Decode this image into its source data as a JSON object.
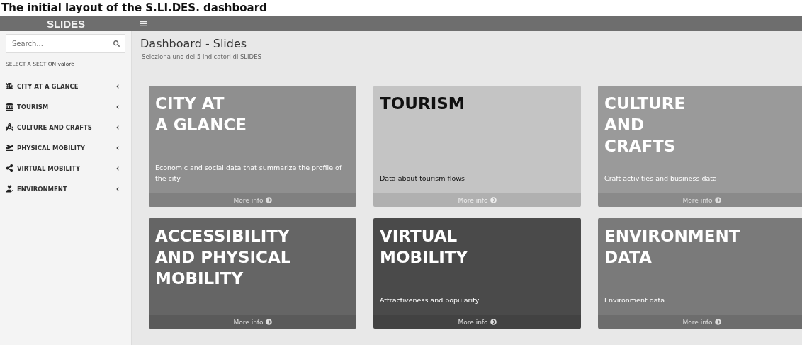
{
  "caption": "The initial layout of the S.LI.DES. dashboard",
  "header": {
    "logo": "SLIDES",
    "menu_glyph": "≡"
  },
  "sidebar": {
    "search": {
      "placeholder": "Search..."
    },
    "section_label": "SELECT A SECTION valore",
    "items": [
      {
        "label": "CITY AT A GLANCE",
        "expanded": false
      },
      {
        "label": "TOURISM",
        "expanded": false
      },
      {
        "label": "CULTURE AND CRAFTS",
        "expanded": false
      },
      {
        "label": "PHYSICAL MOBILITY",
        "expanded": false
      },
      {
        "label": "VIRTUAL MOBILITY",
        "expanded": false
      },
      {
        "label": "ENVIRONMENT",
        "expanded": false
      }
    ]
  },
  "main": {
    "title": "Dashboard - Slides",
    "subtitle": "Seleziona uno dei 5 indicatori di SLIDES",
    "cards": [
      {
        "title_lines": [
          "CITY AT",
          "A GLANCE"
        ],
        "description": "Economic and social data that summarize the profile of the city",
        "link": "More info",
        "color": "#8f8f8f"
      },
      {
        "title_lines": [
          "TOURISM"
        ],
        "description": "Data about tourism flows",
        "link": "More info",
        "color": "#c4c4c4"
      },
      {
        "title_lines": [
          "CULTURE",
          "AND",
          "CRAFTS"
        ],
        "description": "Craft activities and business data",
        "link": "More info",
        "color": "#9a9a9a"
      },
      {
        "title_lines": [
          "ACCESSIBILITY",
          "AND PHYSICAL",
          "MOBILITY"
        ],
        "link": "More info",
        "color": "#656565"
      },
      {
        "title_lines": [
          "VIRTUAL",
          "MOBILITY"
        ],
        "description": "Attractiveness and popularity",
        "link": "More info",
        "color": "#4a4a4a"
      },
      {
        "title_lines": [
          "ENVIRONMENT",
          "DATA"
        ],
        "description": "Environment data",
        "link": "More info",
        "color": "#7a7a7a"
      }
    ]
  }
}
